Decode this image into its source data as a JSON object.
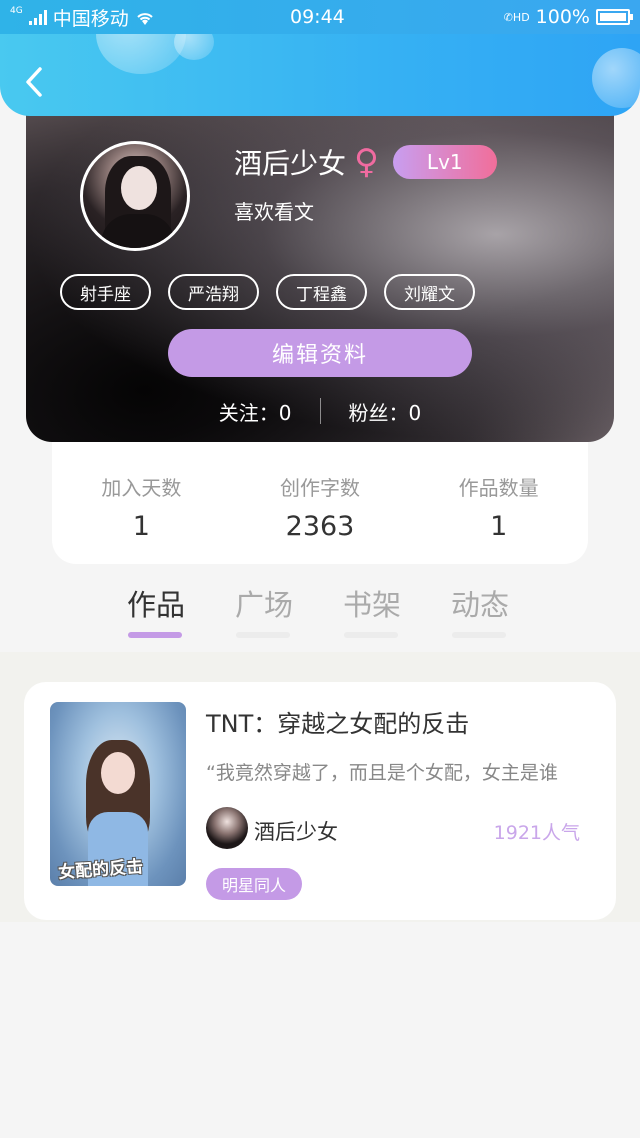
{
  "status_bar": {
    "network_tag": "4G",
    "carrier": "中国移动",
    "time": "09:44",
    "hd_label": "HD",
    "battery": "100%",
    "battery_level": 1.0
  },
  "header": {
    "back_icon": "chevron-left-icon"
  },
  "profile": {
    "nickname": "酒后少女",
    "gender_symbol": "♀",
    "level": "Lv1",
    "bio": "喜欢看文",
    "tags": [
      "射手座",
      "严浩翔",
      "丁程鑫",
      "刘耀文"
    ],
    "edit_label": "编辑资料",
    "following_label": "关注：0",
    "followers_label": "粉丝：0"
  },
  "stats": [
    {
      "label": "加入天数",
      "value": "1"
    },
    {
      "label": "创作字数",
      "value": "2363"
    },
    {
      "label": "作品数量",
      "value": "1"
    }
  ],
  "tabs": [
    {
      "label": "作品",
      "active": true
    },
    {
      "label": "广场",
      "active": false
    },
    {
      "label": "书架",
      "active": false
    },
    {
      "label": "动态",
      "active": false
    }
  ],
  "works": [
    {
      "cover_text": "女配的反击",
      "title": "TNT：穿越之女配的反击",
      "intro": "“我竟然穿越了，而且是个女配，女主是谁",
      "author": "酒后少女",
      "popularity": "1921人气",
      "category": "明星同人"
    }
  ],
  "colors": {
    "accent_purple": "#c49ae6",
    "header_blue": "#36b1f3",
    "gender_pink": "#f06ba0"
  }
}
